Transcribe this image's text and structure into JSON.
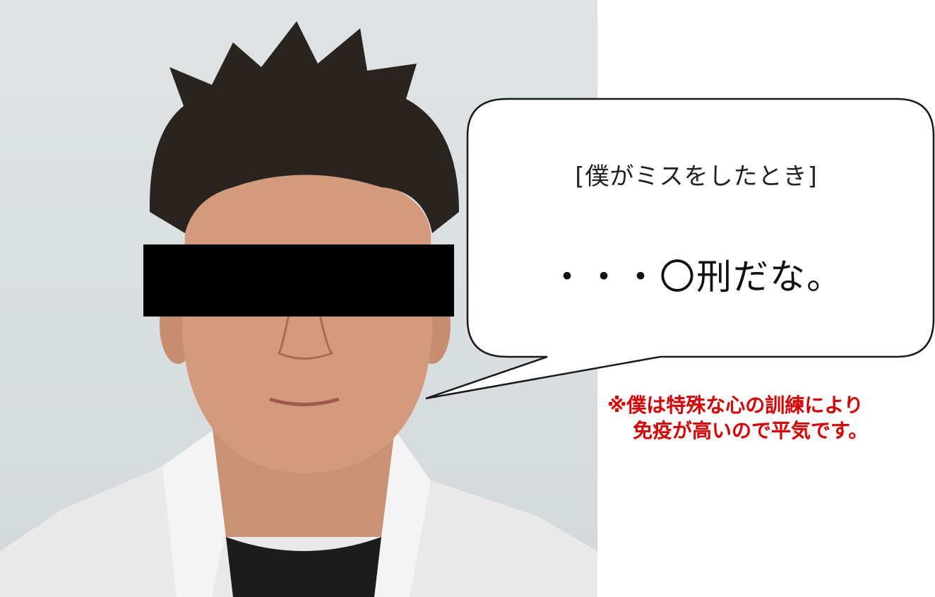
{
  "photo": {
    "subject": "man-portrait",
    "censor_color": "#000000"
  },
  "speech_bubble": {
    "heading": "[僕がミスをしたとき]",
    "text": "・・・〇刑だな。"
  },
  "note": {
    "line1": "※僕は特殊な心の訓練により",
    "line2": "免疫が高いので平気です。",
    "color": "#e00000"
  }
}
